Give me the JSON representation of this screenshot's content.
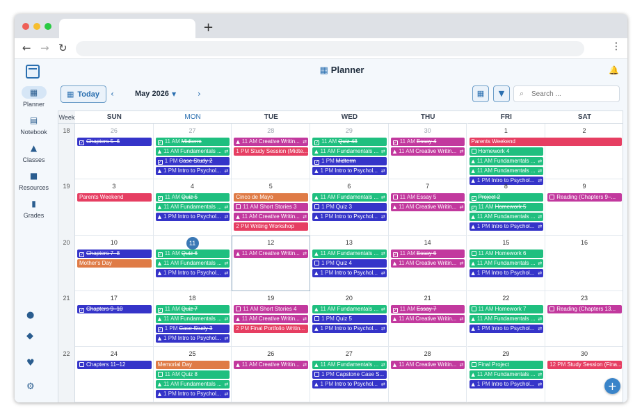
{
  "colors": {
    "blue": "#3534c9",
    "green": "#1fbf7f",
    "magenta": "#c2399e",
    "red": "#e63e62",
    "orange": "#df7b46",
    "accent": "#2a6fb0"
  },
  "sidebar": {
    "items": [
      {
        "label": "Planner",
        "icon": "calendar-icon"
      },
      {
        "label": "Notebook",
        "icon": "notebook-icon"
      },
      {
        "label": "Classes",
        "icon": "graduation-cap-icon"
      },
      {
        "label": "Resources",
        "icon": "book-icon"
      },
      {
        "label": "Grades",
        "icon": "bar-chart-icon"
      }
    ],
    "bottom_icons": [
      "apple-icon",
      "android-icon",
      "hand-heart-icon",
      "gear-icon"
    ]
  },
  "header": {
    "title": "Planner",
    "today_label": "Today",
    "month_label": "May 2026",
    "search_placeholder": "Search ..."
  },
  "calendar": {
    "week_label": "Week",
    "days": [
      "SUN",
      "MON",
      "TUE",
      "WED",
      "THU",
      "FRI",
      "SAT"
    ],
    "weeks": [
      {
        "num": "18",
        "dates": [
          "26",
          "27",
          "28",
          "29",
          "30",
          "1",
          "2"
        ],
        "muted": [
          true,
          true,
          true,
          true,
          true,
          false,
          false
        ],
        "events": [
          [
            {
              "t": "Chapters 5–6",
              "c": "blue",
              "k": "task",
              "d": true
            }
          ],
          [
            {
              "t": "Midterm",
              "c": "green",
              "k": "task",
              "tm": "11 AM",
              "d": true
            },
            {
              "t": "Fundamentals ...",
              "c": "green",
              "k": "class",
              "tm": "11 AM",
              "r": true
            },
            {
              "t": "Case Study 2",
              "c": "blue",
              "k": "task",
              "tm": "1 PM",
              "d": true
            },
            {
              "t": "Intro to Psychol...",
              "c": "blue",
              "k": "class",
              "tm": "1 PM",
              "r": true
            }
          ],
          [
            {
              "t": "Creative Writin...",
              "c": "magenta",
              "k": "class",
              "tm": "11 AM",
              "r": true
            },
            {
              "t": "Study Session (Midte...",
              "c": "red",
              "k": "plain",
              "tm": "1 PM"
            }
          ],
          [
            {
              "t": "Quiz 48",
              "c": "green",
              "k": "task",
              "tm": "11 AM",
              "d": true
            },
            {
              "t": "Fundamentals ...",
              "c": "green",
              "k": "class",
              "tm": "11 AM",
              "r": true
            },
            {
              "t": "Midterm",
              "c": "blue",
              "k": "task",
              "tm": "1 PM",
              "d": true
            },
            {
              "t": "Intro to Psychol...",
              "c": "blue",
              "k": "class",
              "tm": "1 PM",
              "r": true
            }
          ],
          [
            {
              "t": "Essay 4",
              "c": "magenta",
              "k": "task",
              "tm": "11 AM",
              "d": true
            },
            {
              "t": "Creative Writin...",
              "c": "magenta",
              "k": "class",
              "tm": "11 AM",
              "r": true
            }
          ],
          [
            {
              "t": "Parents Weekend",
              "c": "red",
              "k": "plain",
              "span": 2
            },
            {
              "t": "Homework 4",
              "c": "green",
              "k": "task",
              "tm": ""
            },
            {
              "t": "Fundamentals ...",
              "c": "green",
              "k": "class",
              "tm": "11 AM",
              "r": true
            },
            {
              "t": "Fundamentals ...",
              "c": "green",
              "k": "class",
              "tm": "11 AM",
              "r": true
            },
            {
              "t": "Intro to Psychol...",
              "c": "blue",
              "k": "class",
              "tm": "1 PM",
              "r": true
            }
          ],
          []
        ]
      },
      {
        "num": "19",
        "dates": [
          "3",
          "4",
          "5",
          "6",
          "7",
          "8",
          "9"
        ],
        "muted": [
          false,
          false,
          false,
          false,
          false,
          false,
          false
        ],
        "events": [
          [
            {
              "t": "Parents Weekend",
              "c": "red",
              "k": "plain"
            }
          ],
          [
            {
              "t": "Quiz 5",
              "c": "green",
              "k": "task",
              "tm": "11 AM",
              "d": true
            },
            {
              "t": "Fundamentals ...",
              "c": "green",
              "k": "class",
              "tm": "11 AM",
              "r": true
            },
            {
              "t": "Intro to Psychol...",
              "c": "blue",
              "k": "class",
              "tm": "1 PM",
              "r": true
            }
          ],
          [
            {
              "t": "Cinco de Mayo",
              "c": "orange",
              "k": "plain"
            },
            {
              "t": "Short Stories 3",
              "c": "magenta",
              "k": "task",
              "tm": "11 AM"
            },
            {
              "t": "Creative Writin...",
              "c": "magenta",
              "k": "class",
              "tm": "11 AM",
              "r": true
            },
            {
              "t": "Writing Workshop",
              "c": "red",
              "k": "plain",
              "tm": "2 PM"
            }
          ],
          [
            {
              "t": "Fundamentals ...",
              "c": "green",
              "k": "class",
              "tm": "11 AM",
              "r": true
            },
            {
              "t": "Quiz 3",
              "c": "blue",
              "k": "task",
              "tm": "1 PM"
            },
            {
              "t": "Intro to Psychol...",
              "c": "blue",
              "k": "class",
              "tm": "1 PM",
              "r": true
            }
          ],
          [
            {
              "t": "Essay 5",
              "c": "magenta",
              "k": "task",
              "tm": "11 AM"
            },
            {
              "t": "Creative Writin...",
              "c": "magenta",
              "k": "class",
              "tm": "11 AM",
              "r": true
            }
          ],
          [
            {
              "t": "Project 2",
              "c": "green",
              "k": "task",
              "tm": "",
              "d": true
            },
            {
              "t": "Homework 5",
              "c": "green",
              "k": "task",
              "tm": "11 AM",
              "d": true
            },
            {
              "t": "Fundamentals ...",
              "c": "green",
              "k": "class",
              "tm": "11 AM",
              "r": true
            },
            {
              "t": "Intro to Psychol...",
              "c": "blue",
              "k": "class",
              "tm": "1 PM",
              "r": true
            }
          ],
          [
            {
              "t": "Reading (Chapters 9–...",
              "c": "magenta",
              "k": "task"
            }
          ]
        ]
      },
      {
        "num": "20",
        "dates": [
          "10",
          "11",
          "12",
          "13",
          "14",
          "15",
          "16"
        ],
        "muted": [
          false,
          false,
          false,
          false,
          false,
          false,
          false
        ],
        "today": 1,
        "selected": 2,
        "events": [
          [
            {
              "t": "Chapters 7–8",
              "c": "blue",
              "k": "task",
              "d": true
            },
            {
              "t": "Mother's Day",
              "c": "orange",
              "k": "plain"
            }
          ],
          [
            {
              "t": "Quiz 6",
              "c": "green",
              "k": "task",
              "tm": "11 AM",
              "d": true
            },
            {
              "t": "Fundamentals ...",
              "c": "green",
              "k": "class",
              "tm": "11 AM",
              "r": true
            },
            {
              "t": "Intro to Psychol...",
              "c": "blue",
              "k": "class",
              "tm": "1 PM",
              "r": true
            }
          ],
          [
            {
              "t": "Creative Writin...",
              "c": "magenta",
              "k": "class",
              "tm": "11 AM",
              "r": true
            }
          ],
          [
            {
              "t": "Fundamentals ...",
              "c": "green",
              "k": "class",
              "tm": "11 AM",
              "r": true
            },
            {
              "t": "Quiz 4",
              "c": "blue",
              "k": "task",
              "tm": "1 PM"
            },
            {
              "t": "Intro to Psychol...",
              "c": "blue",
              "k": "class",
              "tm": "1 PM",
              "r": true
            }
          ],
          [
            {
              "t": "Essay 6",
              "c": "magenta",
              "k": "task",
              "tm": "11 AM",
              "d": true
            },
            {
              "t": "Creative Writin...",
              "c": "magenta",
              "k": "class",
              "tm": "11 AM",
              "r": true
            }
          ],
          [
            {
              "t": "Homework 6",
              "c": "green",
              "k": "task",
              "tm": "11 AM"
            },
            {
              "t": "Fundamentals ...",
              "c": "green",
              "k": "class",
              "tm": "11 AM",
              "r": true
            },
            {
              "t": "Intro to Psychol...",
              "c": "blue",
              "k": "class",
              "tm": "1 PM",
              "r": true
            }
          ],
          []
        ]
      },
      {
        "num": "21",
        "dates": [
          "17",
          "18",
          "19",
          "20",
          "21",
          "22",
          "23"
        ],
        "muted": [
          false,
          false,
          false,
          false,
          false,
          false,
          false
        ],
        "events": [
          [
            {
              "t": "Chapters 9–10",
              "c": "blue",
              "k": "task",
              "d": true
            }
          ],
          [
            {
              "t": "Quiz 7",
              "c": "green",
              "k": "task",
              "tm": "11 AM",
              "d": true
            },
            {
              "t": "Fundamentals ...",
              "c": "green",
              "k": "class",
              "tm": "11 AM",
              "r": true
            },
            {
              "t": "Case Study 3",
              "c": "blue",
              "k": "task",
              "tm": "1 PM",
              "d": true
            },
            {
              "t": "Intro to Psychol...",
              "c": "blue",
              "k": "class",
              "tm": "1 PM",
              "r": true
            }
          ],
          [
            {
              "t": "Short Stories 4",
              "c": "magenta",
              "k": "task",
              "tm": "11 AM"
            },
            {
              "t": "Creative Writin...",
              "c": "magenta",
              "k": "class",
              "tm": "11 AM",
              "r": true
            },
            {
              "t": "Final Portfolio Writin...",
              "c": "red",
              "k": "plain",
              "tm": "2 PM"
            }
          ],
          [
            {
              "t": "Fundamentals ...",
              "c": "green",
              "k": "class",
              "tm": "11 AM",
              "r": true
            },
            {
              "t": "Quiz 5",
              "c": "blue",
              "k": "task",
              "tm": "1 PM"
            },
            {
              "t": "Intro to Psychol...",
              "c": "blue",
              "k": "class",
              "tm": "1 PM",
              "r": true
            }
          ],
          [
            {
              "t": "Essay 7",
              "c": "magenta",
              "k": "task",
              "tm": "11 AM",
              "d": true
            },
            {
              "t": "Creative Writin...",
              "c": "magenta",
              "k": "class",
              "tm": "11 AM",
              "r": true
            }
          ],
          [
            {
              "t": "Homework 7",
              "c": "green",
              "k": "task",
              "tm": "11 AM"
            },
            {
              "t": "Fundamentals ...",
              "c": "green",
              "k": "class",
              "tm": "11 AM",
              "r": true
            },
            {
              "t": "Intro to Psychol...",
              "c": "blue",
              "k": "class",
              "tm": "1 PM",
              "r": true
            }
          ],
          [
            {
              "t": "Reading (Chapters 13...",
              "c": "magenta",
              "k": "task"
            }
          ]
        ]
      },
      {
        "num": "22",
        "dates": [
          "24",
          "25",
          "26",
          "27",
          "28",
          "29",
          "30"
        ],
        "muted": [
          false,
          false,
          false,
          false,
          false,
          false,
          false
        ],
        "events": [
          [
            {
              "t": "Chapters 11–12",
              "c": "blue",
              "k": "task"
            }
          ],
          [
            {
              "t": "Memorial Day",
              "c": "orange",
              "k": "plain"
            },
            {
              "t": "Quiz 8",
              "c": "green",
              "k": "task",
              "tm": "11 AM"
            },
            {
              "t": "Fundamentals ...",
              "c": "green",
              "k": "class",
              "tm": "11 AM",
              "r": true
            },
            {
              "t": "Intro to Psychol...",
              "c": "blue",
              "k": "class",
              "tm": "1 PM",
              "r": true
            }
          ],
          [
            {
              "t": "Creative Writin...",
              "c": "magenta",
              "k": "class",
              "tm": "11 AM",
              "r": true
            }
          ],
          [
            {
              "t": "Fundamentals ...",
              "c": "green",
              "k": "class",
              "tm": "11 AM",
              "r": true
            },
            {
              "t": "Capstone Case S...",
              "c": "blue",
              "k": "task",
              "tm": "1 PM"
            },
            {
              "t": "Intro to Psychol...",
              "c": "blue",
              "k": "class",
              "tm": "1 PM",
              "r": true
            }
          ],
          [
            {
              "t": "Creative Writin...",
              "c": "magenta",
              "k": "class",
              "tm": "11 AM",
              "r": true
            }
          ],
          [
            {
              "t": "Final Project",
              "c": "green",
              "k": "task",
              "tm": ""
            },
            {
              "t": "Fundamentals ...",
              "c": "green",
              "k": "class",
              "tm": "11 AM",
              "r": true
            },
            {
              "t": "Intro to Psychol...",
              "c": "blue",
              "k": "class",
              "tm": "1 PM",
              "r": true
            }
          ],
          [
            {
              "t": "Study Session (Fina...",
              "c": "red",
              "k": "plain",
              "tm": "12 PM"
            }
          ]
        ]
      }
    ]
  },
  "fab": {
    "label": "+"
  }
}
